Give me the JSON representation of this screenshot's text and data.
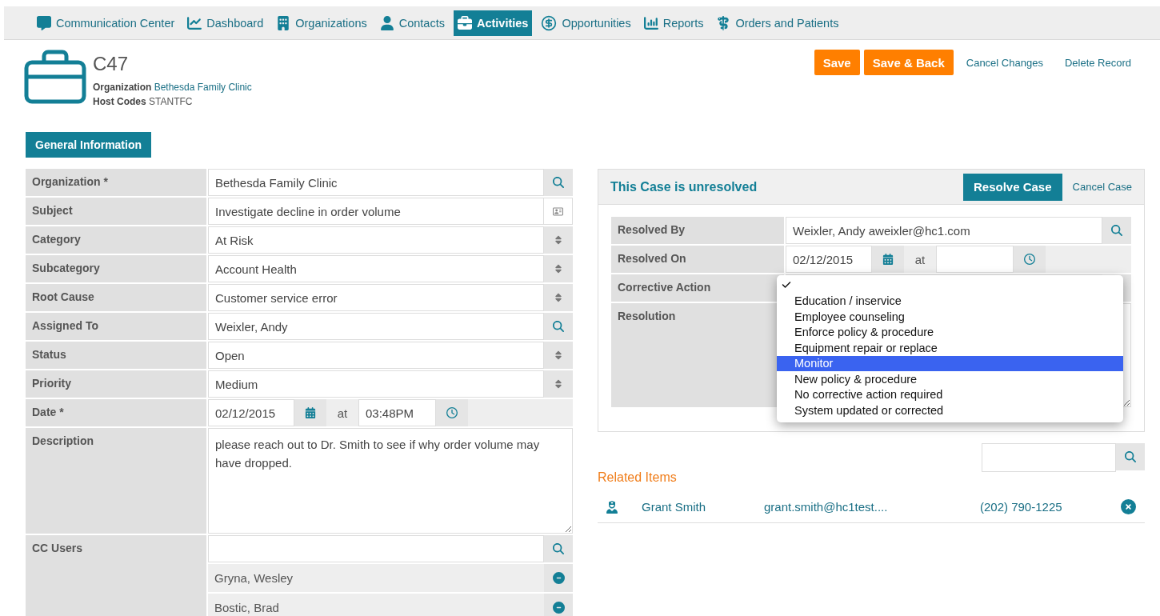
{
  "nav": [
    {
      "label": "Communication Center",
      "selected": false
    },
    {
      "label": "Dashboard",
      "selected": false
    },
    {
      "label": "Organizations",
      "selected": false
    },
    {
      "label": "Contacts",
      "selected": false
    },
    {
      "label": "Activities",
      "selected": true
    },
    {
      "label": "Opportunities",
      "selected": false
    },
    {
      "label": "Reports",
      "selected": false
    },
    {
      "label": "Orders and Patients",
      "selected": false
    }
  ],
  "record": {
    "title": "C47",
    "fields": [
      {
        "label": "Organization",
        "value": "Bethesda Family Clinic",
        "link": true
      },
      {
        "label": "Host Codes",
        "value": "STANTFC",
        "link": false
      }
    ]
  },
  "actions": [
    {
      "label": "Save",
      "kind": "primary"
    },
    {
      "label": "Save & Back",
      "kind": "primary"
    },
    {
      "label": "Cancel Changes",
      "kind": "link"
    },
    {
      "label": "Delete Record",
      "kind": "link"
    }
  ],
  "tabs": [
    {
      "label": "General Information",
      "selected": true
    }
  ],
  "form": [
    {
      "label": "Organization *",
      "kind": "lookup",
      "value": "Bethesda Family Clinic"
    },
    {
      "label": "Subject",
      "kind": "text",
      "value": "Investigate decline in order volume"
    },
    {
      "label": "Category",
      "kind": "select",
      "value": "At Risk"
    },
    {
      "label": "Subcategory",
      "kind": "select",
      "value": "Account Health"
    },
    {
      "label": "Root Cause",
      "kind": "select",
      "value": "Customer service error"
    },
    {
      "label": "Assigned To",
      "kind": "lookup",
      "value": "Weixler, Andy"
    },
    {
      "label": "Status",
      "kind": "select",
      "value": "Open"
    },
    {
      "label": "Priority",
      "kind": "select",
      "value": "Medium"
    },
    {
      "label": "Date *",
      "kind": "datetime",
      "date": "02/12/2015",
      "at": "at",
      "time": "03:48PM"
    },
    {
      "label": "Description",
      "kind": "textarea",
      "value": "please reach out to Dr. Smith to see if why order volume may have dropped."
    },
    {
      "label": "CC Users",
      "kind": "users",
      "users": [
        "Gryna, Wesley",
        "Bostic, Brad"
      ]
    }
  ],
  "case": {
    "title": "This Case is unresolved",
    "actions": [
      {
        "label": "Resolve Case",
        "kind": "primary"
      },
      {
        "label": "Cancel Case",
        "kind": "link"
      }
    ],
    "rows": [
      {
        "label": "Resolved By",
        "kind": "lookup",
        "value": "Weixler, Andy aweixler@hc1.com"
      },
      {
        "label": "Resolved On",
        "kind": "datetime",
        "date": "02/12/2015",
        "at": "at"
      },
      {
        "label": "Corrective Action",
        "kind": "select"
      },
      {
        "label": "Resolution",
        "kind": "textarea"
      }
    ],
    "dropdown": {
      "options": [
        {
          "checked": true,
          "highlighted": false
        },
        {
          "label": "Education / inservice",
          "checked": false,
          "highlighted": false
        },
        {
          "label": "Employee counseling",
          "checked": false,
          "highlighted": false
        },
        {
          "label": "Enforce policy & procedure",
          "checked": false,
          "highlighted": false
        },
        {
          "label": "Equipment repair or replace",
          "checked": false,
          "highlighted": false
        },
        {
          "label": "Monitor",
          "checked": false,
          "highlighted": true
        },
        {
          "label": "New policy & procedure",
          "checked": false,
          "highlighted": false
        },
        {
          "label": "No corrective action required",
          "checked": false,
          "highlighted": false
        },
        {
          "label": "System updated or corrected",
          "checked": false,
          "highlighted": false
        }
      ]
    }
  },
  "related": {
    "title": "Related Items",
    "items": [
      {
        "name": "Grant Smith",
        "email": "grant.smith@hc1test....",
        "phone": "(202) 790-1225"
      }
    ]
  }
}
